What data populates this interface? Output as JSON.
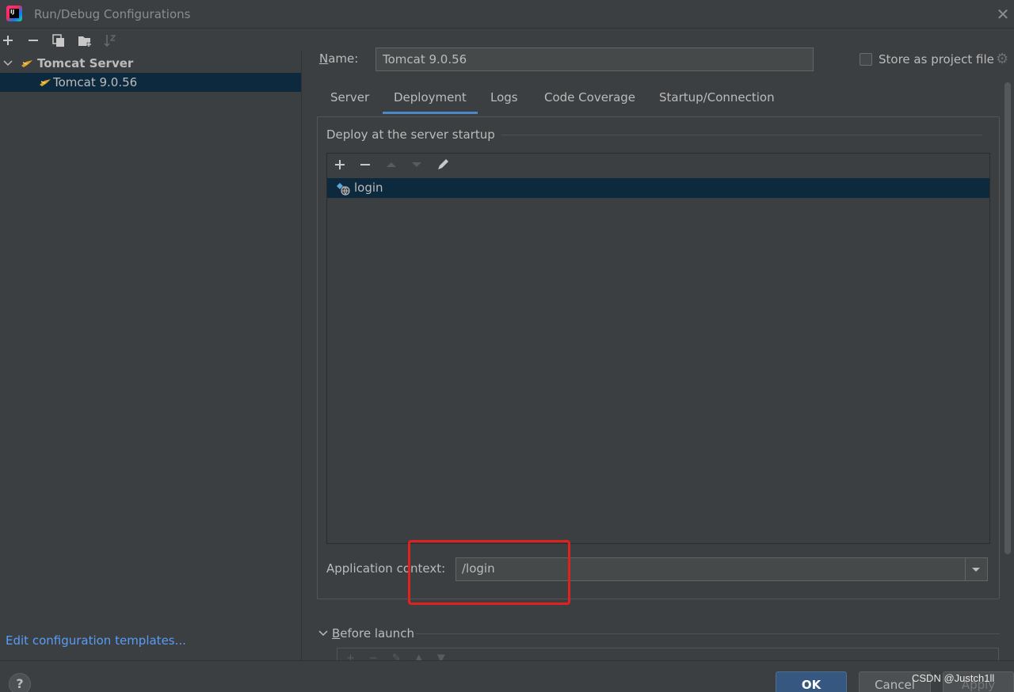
{
  "window": {
    "title": "Run/Debug Configurations",
    "app_icon_text": "IJ"
  },
  "left_toolbar": {
    "icons": [
      "plus-icon",
      "minus-icon",
      "copy-icon",
      "folder-add-icon",
      "sort-icon"
    ]
  },
  "tree": {
    "group_label": "Tomcat Server",
    "item_label": "Tomcat 9.0.56"
  },
  "edit_templates_link": "Edit configuration templates...",
  "name_field": {
    "label": "Name:",
    "value": "Tomcat 9.0.56"
  },
  "store_as_project_file": {
    "label": "Store as project file",
    "checked": false
  },
  "tabs": [
    {
      "label": "Server",
      "active": false
    },
    {
      "label": "Deployment",
      "active": true
    },
    {
      "label": "Logs",
      "active": false
    },
    {
      "label": "Code Coverage",
      "active": false
    },
    {
      "label": "Startup/Connection",
      "active": false
    }
  ],
  "deployment": {
    "title": "Deploy at the server startup",
    "artifacts": [
      "login"
    ],
    "app_context_label": "Application context:",
    "app_context_value": "/login"
  },
  "before_launch": {
    "label": "Before launch"
  },
  "buttons": {
    "help": "?",
    "ok": "OK",
    "cancel": "Cancel",
    "apply": "Apply"
  },
  "watermark": "CSDN @Justch1ll",
  "colors": {
    "background": "#3c3f41",
    "selection": "#0d293e",
    "link": "#589df6",
    "ok_button": "#365880",
    "tab_underline": "#4a88c7",
    "highlight_box": "#e0211d"
  }
}
